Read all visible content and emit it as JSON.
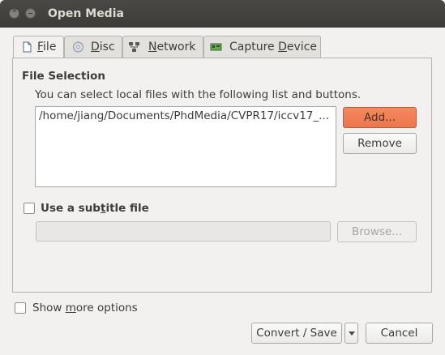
{
  "window": {
    "title": "Open Media"
  },
  "tabs": [
    {
      "label": "File",
      "underline": "F",
      "rest": "ile",
      "icon": "file-icon"
    },
    {
      "label": "Disc",
      "underline": "D",
      "rest": "isc",
      "icon": "disc-icon"
    },
    {
      "label": "Network",
      "underline": "N",
      "rest": "etwork",
      "icon": "network-icon"
    },
    {
      "label": "Capture Device",
      "pre": "Capture ",
      "underline": "D",
      "rest": "evice",
      "icon": "capture-card-icon"
    }
  ],
  "file_section": {
    "title": "File Selection",
    "description": "You can select local files with the following list and buttons.",
    "files": [
      "/home/jiang/Documents/PhdMedia/CVPR17/iccv17_..."
    ],
    "add_label": "Add...",
    "remove_label": "Remove"
  },
  "subtitle": {
    "label_pre": "Use a sub",
    "label_u": "t",
    "label_post": "itle file",
    "checked": false,
    "path_value": "",
    "browse_label": "Browse..."
  },
  "more_options": {
    "label_pre": "Show ",
    "label_u": "m",
    "label_post": "ore options",
    "checked": false
  },
  "footer": {
    "convert_label": "Convert / Save",
    "cancel_label": "Cancel"
  },
  "colors": {
    "accent": "#ed764b",
    "titlebar": "#3c3b37"
  }
}
